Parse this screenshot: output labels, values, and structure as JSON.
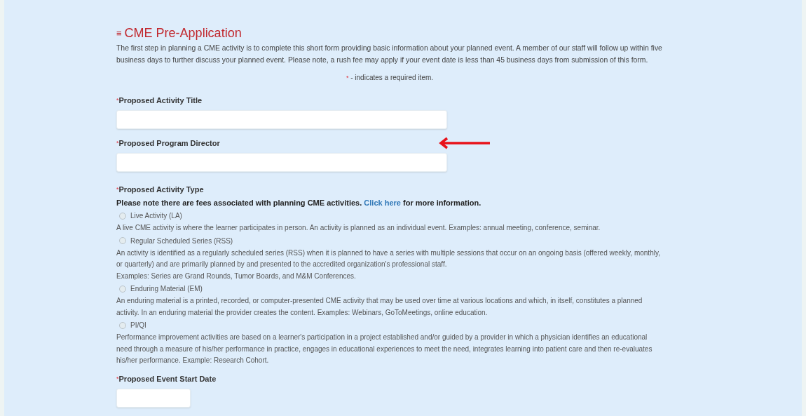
{
  "header": {
    "icon": "≡",
    "title": "CME Pre-Application",
    "intro": "The first step in planning a CME activity is to complete this short form providing basic information about your planned event. A member of our staff will follow up within five business days to further discuss your planned event. Please note, a rush fee may apply if your event date is less than 45 business days from submission of this form.",
    "required_mark": "*",
    "required_note": " - indicates a required item."
  },
  "fields": [
    {
      "kind": "text",
      "label": "Proposed Activity Title",
      "required": true
    },
    {
      "kind": "text",
      "label": "Proposed Program Director",
      "required": true
    },
    {
      "kind": "radio",
      "label": "Proposed Activity Type",
      "required": true,
      "note_before": "Please note there are fees associated with planning CME activities. ",
      "note_link": "Click here",
      "note_after": " for more information.",
      "options": [
        {
          "label": "Live Activity (LA)",
          "selected": false,
          "description": [
            "A live CME activity is where the learner participates in person. An activity is planned as an individual event. Examples: annual meeting, conference, seminar."
          ]
        },
        {
          "label": "Regular Scheduled Series (RSS)",
          "selected": false,
          "description": [
            "An activity is identified as a regularly scheduled series (RSS) when it is planned to have a series with multiple sessions that occur on an ongoing basis (offered weekly, monthly, or quarterly) and are primarily planned by and presented to the accredited organization's professional staff.",
            "Examples: Series are Grand Rounds, Tumor Boards, and M&M Conferences."
          ]
        },
        {
          "label": "Enduring Material (EM)",
          "selected": false,
          "description": [
            "An enduring material is a printed, recorded, or computer-presented CME activity that may be used over time at various locations and which, in itself, constitutes a planned activity. In an enduring material the provider creates the content. Examples: Webinars, GoToMeetings, online education."
          ]
        },
        {
          "label": "PI/QI",
          "selected": false,
          "description": [
            "Performance improvement activities are based on a learner's participation in a project established and/or guided by a provider in which a physician identifies an educational need through a measure of his/her performance in practice, engages in educational experiences to meet the need, integrates learning into patient care and then re-evaluates his/her performance. Example: Research Cohort."
          ]
        }
      ]
    },
    {
      "kind": "date",
      "label": "Proposed Event Start Date",
      "required": true
    }
  ]
}
